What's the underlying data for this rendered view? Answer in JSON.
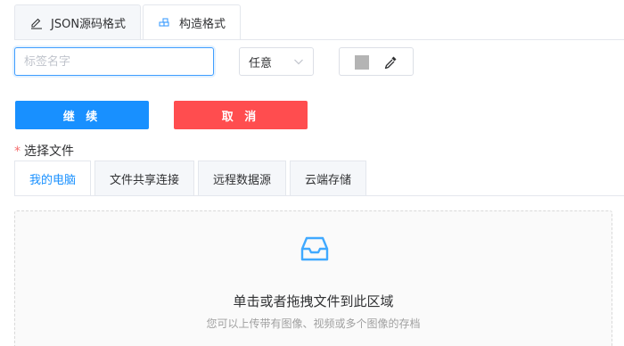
{
  "top_tabs": [
    {
      "label": "JSON源码格式",
      "icon": "edit-icon"
    },
    {
      "label": "构造格式",
      "icon": "blocks-icon"
    }
  ],
  "form": {
    "name_placeholder": "标签名字",
    "name_value": "",
    "select_value": "任意",
    "color_value": "#b4b4b4"
  },
  "buttons": {
    "continue_label": "继 续",
    "cancel_label": "取 消"
  },
  "file": {
    "required_mark": "*",
    "label": "选择文件"
  },
  "source_tabs": [
    {
      "label": "我的电脑"
    },
    {
      "label": "文件共享连接"
    },
    {
      "label": "远程数据源"
    },
    {
      "label": "云端存储"
    }
  ],
  "upload": {
    "icon": "inbox-icon",
    "main_text": "单击或者拖拽文件到此区域",
    "hint_text": "您可以上传带有图像、视频或多个图像的存档"
  },
  "colors": {
    "primary": "#1890ff",
    "danger": "#ff4d4f",
    "focus_border": "#409eff"
  }
}
